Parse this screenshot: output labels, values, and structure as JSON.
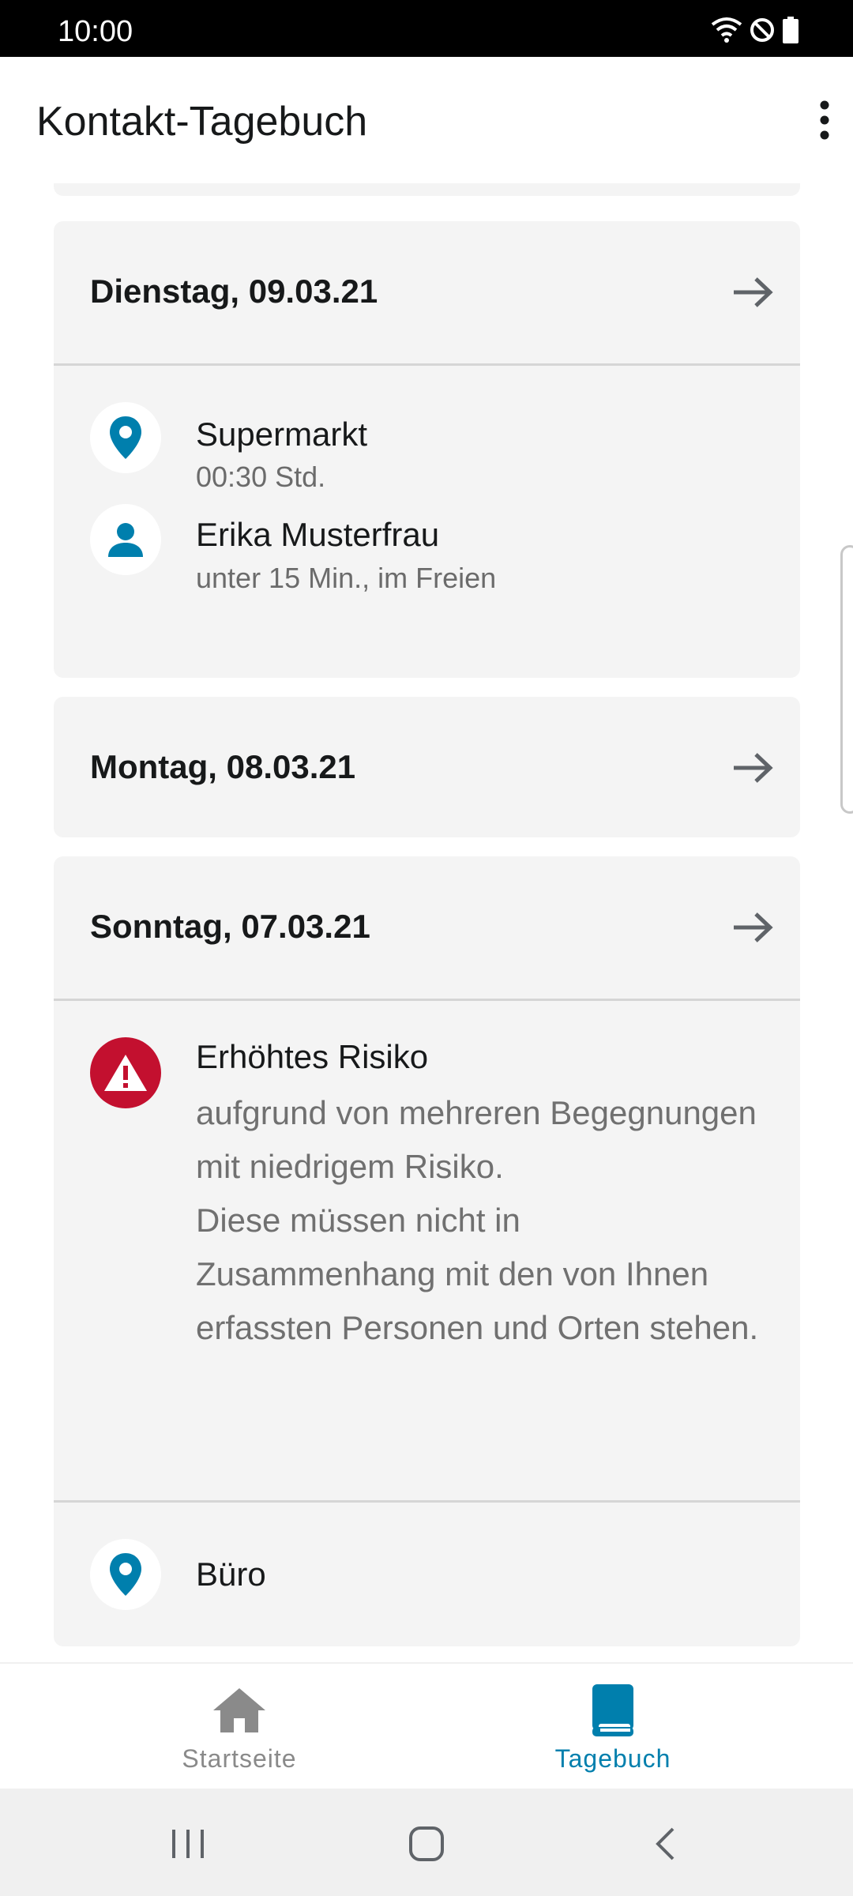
{
  "status_bar": {
    "time": "10:00"
  },
  "app_bar": {
    "title": "Kontakt-Tagebuch"
  },
  "days": [
    {
      "title": "Dienstag, 09.03.21",
      "entries": [
        {
          "icon": "location-pin-icon",
          "title": "Supermarkt",
          "subtitle": "00:30 Std."
        },
        {
          "icon": "person-icon",
          "title": "Erika Musterfrau",
          "subtitle": "unter 15 Min., im Freien"
        }
      ]
    },
    {
      "title": "Montag, 08.03.21",
      "entries": []
    },
    {
      "title": "Sonntag, 07.03.21",
      "risk": {
        "title": "Erhöhtes Risiko",
        "text": "aufgrund von mehreren Begegnungen mit niedrigem Risiko.\nDiese müssen nicht in Zusammenhang mit den von Ihnen erfassten Personen und Orten stehen."
      },
      "entries": [
        {
          "icon": "location-pin-icon",
          "title": "Büro"
        }
      ]
    }
  ],
  "bottom_nav": {
    "items": [
      {
        "label": "Startseite",
        "icon": "home-icon",
        "active": false
      },
      {
        "label": "Tagebuch",
        "icon": "book-icon",
        "active": true
      }
    ]
  },
  "colors": {
    "accent": "#007fad",
    "risk_red": "#c3102f",
    "inactive": "#8a8a8a",
    "card_bg": "#f4f4f4"
  }
}
